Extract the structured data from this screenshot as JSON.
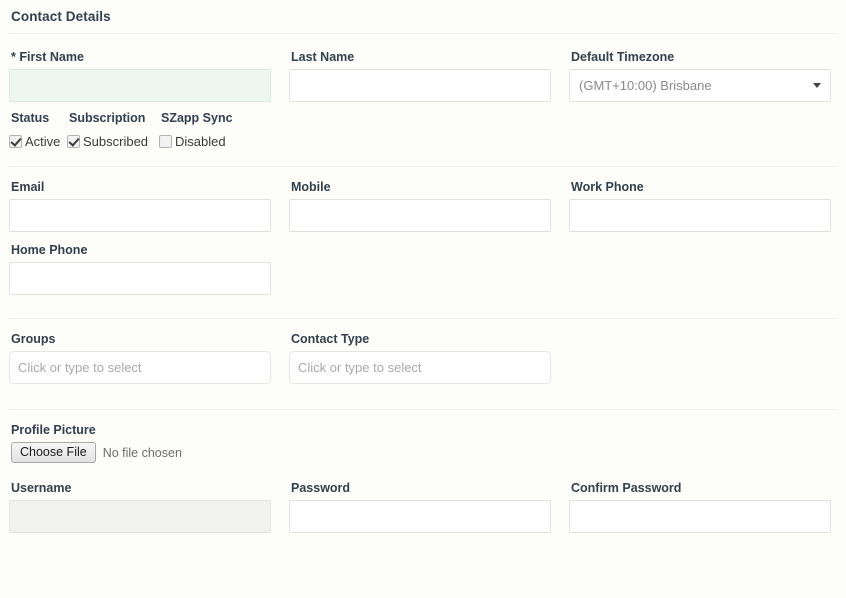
{
  "section": {
    "title": "Contact Details"
  },
  "name_row": {
    "first_name": {
      "label": "* First Name",
      "value": "",
      "placeholder": ""
    },
    "last_name": {
      "label": "Last Name",
      "value": "",
      "placeholder": ""
    },
    "timezone": {
      "label": "Default Timezone",
      "selected": "(GMT+10:00) Brisbane",
      "caret_icon": "chevron-down-icon"
    }
  },
  "toggles": {
    "status": {
      "heading": "Status",
      "option_label": "Active",
      "checked": true
    },
    "subscription": {
      "heading": "Subscription",
      "option_label": "Subscribed",
      "checked": true
    },
    "szapp_sync": {
      "heading": "SZapp Sync",
      "option_label": "Disabled",
      "checked": false
    }
  },
  "contact_row": {
    "email": {
      "label": "Email",
      "value": ""
    },
    "mobile": {
      "label": "Mobile",
      "value": ""
    },
    "work_phone": {
      "label": "Work Phone",
      "value": ""
    },
    "home_phone": {
      "label": "Home Phone",
      "value": ""
    }
  },
  "tags_row": {
    "groups": {
      "label": "Groups",
      "value": "",
      "placeholder": "Click or type to select"
    },
    "contact_type": {
      "label": "Contact Type",
      "value": "",
      "placeholder": "Click or type to select"
    }
  },
  "profile_picture": {
    "label": "Profile Picture",
    "button_label": "Choose File",
    "status_text": "No file chosen"
  },
  "credentials_row": {
    "username": {
      "label": "Username",
      "value": ""
    },
    "password": {
      "label": "Password",
      "value": ""
    },
    "confirm_password": {
      "label": "Confirm Password",
      "value": ""
    }
  }
}
